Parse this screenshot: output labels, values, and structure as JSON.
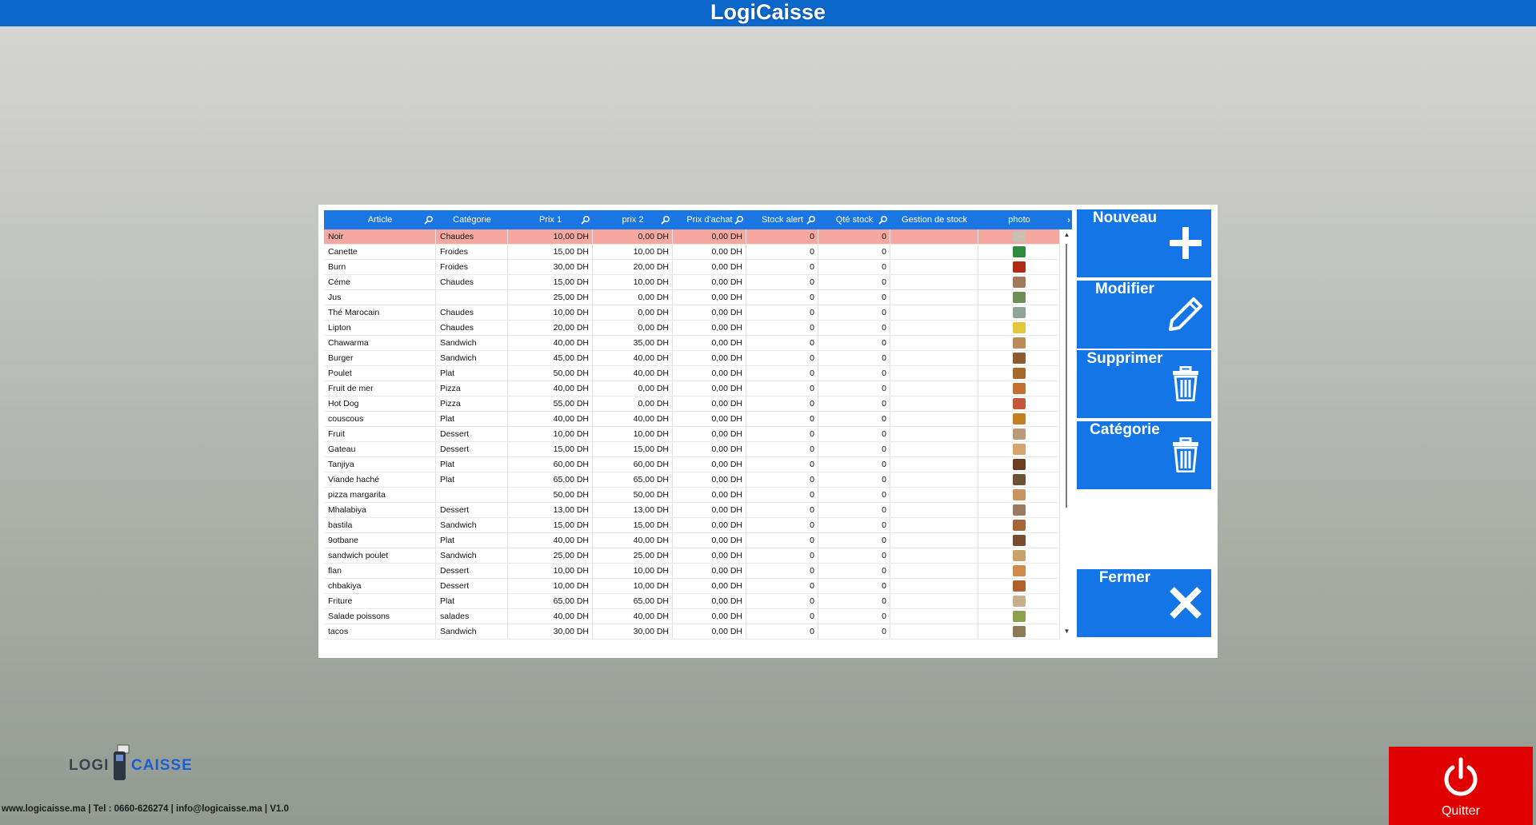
{
  "app": {
    "title": "LogiCaisse"
  },
  "grid": {
    "columns": [
      {
        "label": "Article",
        "search": true
      },
      {
        "label": "Catégorie",
        "search": false
      },
      {
        "label": "Prix 1",
        "search": true
      },
      {
        "label": "prix 2",
        "search": true
      },
      {
        "label": "Prix d'achat",
        "search": true
      },
      {
        "label": "Stock alert",
        "search": true
      },
      {
        "label": "Qté stock",
        "search": true
      },
      {
        "label": "Gestion de stock",
        "search": false
      },
      {
        "label": "photo",
        "search": false
      }
    ],
    "scroll_right_glyph": "›",
    "rows": [
      {
        "article": "Noir",
        "categorie": "Chaudes",
        "prix1": "10,00 DH",
        "prix2": "0,00 DH",
        "achat": "0,00 DH",
        "alert": "0",
        "qte": "0",
        "gestion": "",
        "photo": "#c9c0b3",
        "selected": true
      },
      {
        "article": "Canette",
        "categorie": "Froides",
        "prix1": "15,00 DH",
        "prix2": "10,00 DH",
        "achat": "0,00 DH",
        "alert": "0",
        "qte": "0",
        "gestion": "",
        "photo": "#2f8a3c"
      },
      {
        "article": "Burn",
        "categorie": "Froides",
        "prix1": "30,00 DH",
        "prix2": "20,00 DH",
        "achat": "0,00 DH",
        "alert": "0",
        "qte": "0",
        "gestion": "",
        "photo": "#b12a12"
      },
      {
        "article": "Céme",
        "categorie": "Chaudes",
        "prix1": "15,00 DH",
        "prix2": "10,00 DH",
        "achat": "0,00 DH",
        "alert": "0",
        "qte": "0",
        "gestion": "",
        "photo": "#a2785a"
      },
      {
        "article": "Jus",
        "categorie": "",
        "prix1": "25,00 DH",
        "prix2": "0,00 DH",
        "achat": "0,00 DH",
        "alert": "0",
        "qte": "0",
        "gestion": "",
        "photo": "#6d8e57"
      },
      {
        "article": "Thé Marocain",
        "categorie": "Chaudes",
        "prix1": "10,00 DH",
        "prix2": "0,00 DH",
        "achat": "0,00 DH",
        "alert": "0",
        "qte": "0",
        "gestion": "",
        "photo": "#8ea39a"
      },
      {
        "article": "Lipton",
        "categorie": "Chaudes",
        "prix1": "20,00 DH",
        "prix2": "0,00 DH",
        "achat": "0,00 DH",
        "alert": "0",
        "qte": "0",
        "gestion": "",
        "photo": "#e3c93a"
      },
      {
        "article": "Chawarma",
        "categorie": "Sandwich",
        "prix1": "40,00 DH",
        "prix2": "35,00 DH",
        "achat": "0,00 DH",
        "alert": "0",
        "qte": "0",
        "gestion": "",
        "photo": "#b98c5a"
      },
      {
        "article": "Burger",
        "categorie": "Sandwich",
        "prix1": "45,00 DH",
        "prix2": "40,00 DH",
        "achat": "0,00 DH",
        "alert": "0",
        "qte": "0",
        "gestion": "",
        "photo": "#8c5a2e"
      },
      {
        "article": "Poulet",
        "categorie": "Plat",
        "prix1": "50,00 DH",
        "prix2": "40,00 DH",
        "achat": "0,00 DH",
        "alert": "0",
        "qte": "0",
        "gestion": "",
        "photo": "#a8672b"
      },
      {
        "article": "Fruit de mer",
        "categorie": "Pizza",
        "prix1": "40,00 DH",
        "prix2": "0,00 DH",
        "achat": "0,00 DH",
        "alert": "0",
        "qte": "0",
        "gestion": "",
        "photo": "#c2712f"
      },
      {
        "article": "Hot Dog",
        "categorie": "Pizza",
        "prix1": "55,00 DH",
        "prix2": "0,00 DH",
        "achat": "0,00 DH",
        "alert": "0",
        "qte": "0",
        "gestion": "",
        "photo": "#c4563a"
      },
      {
        "article": "couscous",
        "categorie": "Plat",
        "prix1": "40,00 DH",
        "prix2": "40,00 DH",
        "achat": "0,00 DH",
        "alert": "0",
        "qte": "0",
        "gestion": "",
        "photo": "#c2801f"
      },
      {
        "article": "Fruit",
        "categorie": "Dessert",
        "prix1": "10,00 DH",
        "prix2": "10,00 DH",
        "achat": "0,00 DH",
        "alert": "0",
        "qte": "0",
        "gestion": "",
        "photo": "#b99a7a"
      },
      {
        "article": "Gateau",
        "categorie": "Dessert",
        "prix1": "15,00 DH",
        "prix2": "15,00 DH",
        "achat": "0,00 DH",
        "alert": "0",
        "qte": "0",
        "gestion": "",
        "photo": "#d7a46b"
      },
      {
        "article": "Tanjiya",
        "categorie": "Plat",
        "prix1": "60,00 DH",
        "prix2": "60,00 DH",
        "achat": "0,00 DH",
        "alert": "0",
        "qte": "0",
        "gestion": "",
        "photo": "#6b3e1f"
      },
      {
        "article": "Viande haché",
        "categorie": "Plat",
        "prix1": "65,00 DH",
        "prix2": "65,00 DH",
        "achat": "0,00 DH",
        "alert": "0",
        "qte": "0",
        "gestion": "",
        "photo": "#6a5233"
      },
      {
        "article": "pizza margarita",
        "categorie": "",
        "prix1": "50,00 DH",
        "prix2": "50,00 DH",
        "achat": "0,00 DH",
        "alert": "0",
        "qte": "0",
        "gestion": "",
        "photo": "#c99360"
      },
      {
        "article": "Mhalabiya",
        "categorie": "Dessert",
        "prix1": "13,00 DH",
        "prix2": "13,00 DH",
        "achat": "0,00 DH",
        "alert": "0",
        "qte": "0",
        "gestion": "",
        "photo": "#9a7b60"
      },
      {
        "article": "bastila",
        "categorie": "Sandwich",
        "prix1": "15,00 DH",
        "prix2": "15,00 DH",
        "achat": "0,00 DH",
        "alert": "0",
        "qte": "0",
        "gestion": "",
        "photo": "#a5653a"
      },
      {
        "article": "9otbane",
        "categorie": "Plat",
        "prix1": "40,00 DH",
        "prix2": "40,00 DH",
        "achat": "0,00 DH",
        "alert": "0",
        "qte": "0",
        "gestion": "",
        "photo": "#7a4b2c"
      },
      {
        "article": "sandwich poulet",
        "categorie": "Sandwich",
        "prix1": "25,00 DH",
        "prix2": "25,00 DH",
        "achat": "0,00 DH",
        "alert": "0",
        "qte": "0",
        "gestion": "",
        "photo": "#c8a26a"
      },
      {
        "article": "flan",
        "categorie": "Dessert",
        "prix1": "10,00 DH",
        "prix2": "10,00 DH",
        "achat": "0,00 DH",
        "alert": "0",
        "qte": "0",
        "gestion": "",
        "photo": "#d08a4a"
      },
      {
        "article": "chbakiya",
        "categorie": "Dessert",
        "prix1": "10,00 DH",
        "prix2": "10,00 DH",
        "achat": "0,00 DH",
        "alert": "0",
        "qte": "0",
        "gestion": "",
        "photo": "#b0602a"
      },
      {
        "article": "Friture",
        "categorie": "Plat",
        "prix1": "65,00 DH",
        "prix2": "65,00 DH",
        "achat": "0,00 DH",
        "alert": "0",
        "qte": "0",
        "gestion": "",
        "photo": "#c9b08a"
      },
      {
        "article": "Salade poissons",
        "categorie": "salades",
        "prix1": "40,00 DH",
        "prix2": "40,00 DH",
        "achat": "0,00 DH",
        "alert": "0",
        "qte": "0",
        "gestion": "",
        "photo": "#8aa24a"
      },
      {
        "article": "tacos",
        "categorie": "Sandwich",
        "prix1": "30,00 DH",
        "prix2": "30,00 DH",
        "achat": "0,00 DH",
        "alert": "0",
        "qte": "0",
        "gestion": "",
        "photo": "#8a7a55"
      }
    ]
  },
  "actions": {
    "nouveau": "Nouveau",
    "modifier": "Modifier",
    "supprimer": "Supprimer",
    "categorie": "Catégorie",
    "fermer": "Fermer"
  },
  "logo": {
    "left": "LOGI",
    "right": "CAISSE"
  },
  "footer": {
    "text": "www.logicaisse.ma | Tel : 0660-626274 | info@logicaisse.ma | V1.0"
  },
  "quit": {
    "label": "Quitter"
  },
  "colors": {
    "titlebar": "#0b67c9",
    "header": "#1976e3",
    "button": "#1475e6",
    "selected_row": "#f5a7a0",
    "quit": "#e00000"
  }
}
